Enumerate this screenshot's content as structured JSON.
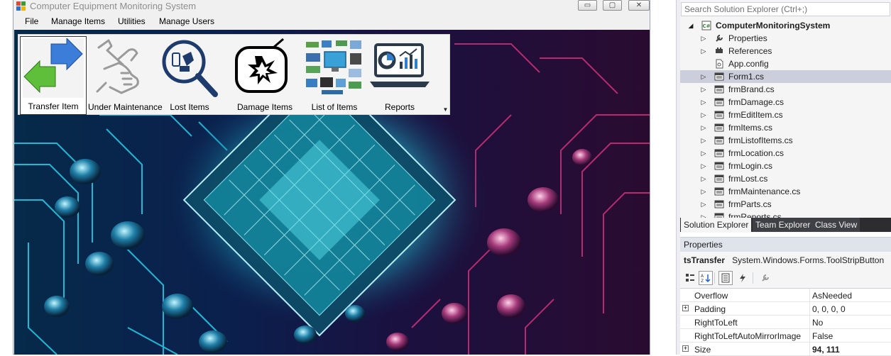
{
  "window": {
    "title": "Computer Equipment Monitoring System",
    "min_glyph": "▭",
    "max_glyph": "▢",
    "close_glyph": "✕"
  },
  "menu": [
    "File",
    "Manage Items",
    "Utilities",
    "Manage Users"
  ],
  "toolstrip": {
    "items": [
      {
        "label": "Transfer Item",
        "icon": "transfer-arrows-icon",
        "selected": true
      },
      {
        "label": "Under Maintenance",
        "icon": "hand-wrench-icon",
        "selected": false
      },
      {
        "label": "Lost Items",
        "icon": "magnifier-devices-icon",
        "selected": false
      },
      {
        "label": "Damage Items",
        "icon": "broken-tv-icon",
        "selected": false
      },
      {
        "label": "List of Items",
        "icon": "computer-parts-icon",
        "selected": false
      },
      {
        "label": "Reports",
        "icon": "laptop-report-icon",
        "selected": false
      }
    ],
    "overflow_glyph": "▼"
  },
  "solution_explorer": {
    "search_placeholder": "Search Solution Explorer (Ctrl+;)",
    "tree": [
      {
        "label": "ComputerMonitoringSystem",
        "level": 0,
        "arrow": "◢",
        "icon": "csharp-project-icon",
        "bold": true,
        "selected": false
      },
      {
        "label": "Properties",
        "level": 1,
        "arrow": "▷",
        "icon": "wrench-icon",
        "bold": false,
        "selected": false
      },
      {
        "label": "References",
        "level": 1,
        "arrow": "▷",
        "icon": "references-icon",
        "bold": false,
        "selected": false
      },
      {
        "label": "App.config",
        "level": 1,
        "arrow": "",
        "icon": "config-file-icon",
        "bold": false,
        "selected": false
      },
      {
        "label": "Form1.cs",
        "level": 1,
        "arrow": "▷",
        "icon": "form-icon",
        "bold": false,
        "selected": true
      },
      {
        "label": "frmBrand.cs",
        "level": 1,
        "arrow": "▷",
        "icon": "form-icon",
        "bold": false,
        "selected": false
      },
      {
        "label": "frmDamage.cs",
        "level": 1,
        "arrow": "▷",
        "icon": "form-icon",
        "bold": false,
        "selected": false
      },
      {
        "label": "frmEditItem.cs",
        "level": 1,
        "arrow": "▷",
        "icon": "form-icon",
        "bold": false,
        "selected": false
      },
      {
        "label": "frmItems.cs",
        "level": 1,
        "arrow": "▷",
        "icon": "form-icon",
        "bold": false,
        "selected": false
      },
      {
        "label": "frmListofItems.cs",
        "level": 1,
        "arrow": "▷",
        "icon": "form-icon",
        "bold": false,
        "selected": false
      },
      {
        "label": "frmLocation.cs",
        "level": 1,
        "arrow": "▷",
        "icon": "form-icon",
        "bold": false,
        "selected": false
      },
      {
        "label": "frmLogin.cs",
        "level": 1,
        "arrow": "▷",
        "icon": "form-icon",
        "bold": false,
        "selected": false
      },
      {
        "label": "frmLost.cs",
        "level": 1,
        "arrow": "▷",
        "icon": "form-icon",
        "bold": false,
        "selected": false
      },
      {
        "label": "frmMaintenance.cs",
        "level": 1,
        "arrow": "▷",
        "icon": "form-icon",
        "bold": false,
        "selected": false
      },
      {
        "label": "frmParts.cs",
        "level": 1,
        "arrow": "▷",
        "icon": "form-icon",
        "bold": false,
        "selected": false
      },
      {
        "label": "frmReports.cs",
        "level": 1,
        "arrow": "▷",
        "icon": "form-icon",
        "bold": false,
        "selected": false
      }
    ],
    "tabs": [
      "Solution Explorer",
      "Team Explorer",
      "Class View"
    ],
    "active_tab": 0
  },
  "properties": {
    "header": "Properties",
    "object_name": "tsTransfer",
    "object_type": "System.Windows.Forms.ToolStripButton",
    "toolbar": [
      {
        "icon": "categorized-icon",
        "active": false
      },
      {
        "icon": "alphabetical-icon",
        "active": true
      },
      {
        "icon": "properties-icon",
        "active": true
      },
      {
        "icon": "events-lightning-icon",
        "active": false
      },
      {
        "icon": "property-pages-wrench-icon",
        "active": false
      }
    ],
    "rows": [
      {
        "name": "Overflow",
        "value": "AsNeeded",
        "expandable": false,
        "bold_value": false
      },
      {
        "name": "Padding",
        "value": "0, 0, 0, 0",
        "expandable": true,
        "bold_value": false
      },
      {
        "name": "RightToLeft",
        "value": "No",
        "expandable": false,
        "bold_value": false
      },
      {
        "name": "RightToLeftAutoMirrorImage",
        "value": "False",
        "expandable": false,
        "bold_value": false
      },
      {
        "name": "Size",
        "value": "94, 111",
        "expandable": true,
        "bold_value": true
      }
    ]
  },
  "colors": {
    "selected_row": "#cccedb",
    "tab_bar": "#2d2d30",
    "properties_header": "#dfe3ea",
    "circuit_cyan": "#22d3ee",
    "circuit_magenta": "#d0307a"
  }
}
